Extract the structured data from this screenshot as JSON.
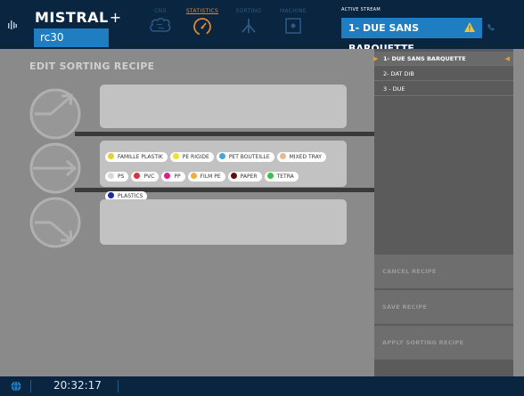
{
  "header": {
    "brand": "MISTRAL",
    "brand_symbol": "+",
    "machine_id": "rc30",
    "tabs": [
      {
        "label": "CNS",
        "icon": "brain-icon",
        "active": false
      },
      {
        "label": "STATISTICS",
        "icon": "gauge-icon",
        "active": true
      },
      {
        "label": "SORTING",
        "icon": "sorting-icon",
        "active": false
      },
      {
        "label": "MACHINE",
        "icon": "machine-icon",
        "active": false
      }
    ],
    "active_stream_label": "ACTIVE STREAM",
    "active_stream_value": "1- DUE SANS BARQUETTE",
    "colors": {
      "bar": "#0a2540",
      "accent_blue": "#1f7ec2",
      "accent_orange": "#e0872f"
    }
  },
  "main": {
    "title": "EDIT SORTING RECIPE",
    "steps": [
      {
        "direction": "up-right",
        "chips": []
      },
      {
        "direction": "straight",
        "chips": [
          {
            "label": "FAMILLE PLASTIK",
            "color": "#e6d12a"
          },
          {
            "label": "PE RIGIDE",
            "color": "#e8e23a"
          },
          {
            "label": "PET BOUTEILLE",
            "color": "#4aa3d6"
          },
          {
            "label": "MIXED TRAY",
            "color": "#e8b890"
          },
          {
            "label": "PS",
            "color": "#d8d8d8"
          },
          {
            "label": "PVC",
            "color": "#e0303c"
          },
          {
            "label": "PP",
            "color": "#d8208a"
          },
          {
            "label": "FILM PE",
            "color": "#f0b040"
          },
          {
            "label": "PAPER",
            "color": "#5a1414"
          },
          {
            "label": "TETRA",
            "color": "#38c048"
          },
          {
            "label": "PLASTICS",
            "color": "#1c2aa0"
          }
        ]
      },
      {
        "direction": "down-right",
        "chips": []
      }
    ]
  },
  "panel": {
    "recipes": [
      {
        "label": "1- DUE SANS BARQUETTE",
        "selected": true
      },
      {
        "label": "2- DAT DIB",
        "selected": false
      },
      {
        "label": "3 - DUE",
        "selected": false
      }
    ],
    "buttons": {
      "cancel": "CANCEL RECIPE",
      "save": "SAVE RECIPE",
      "apply": "APPLY SORTING RECIPE"
    }
  },
  "status": {
    "time": "20:32:17",
    "icon": "globe-icon"
  }
}
